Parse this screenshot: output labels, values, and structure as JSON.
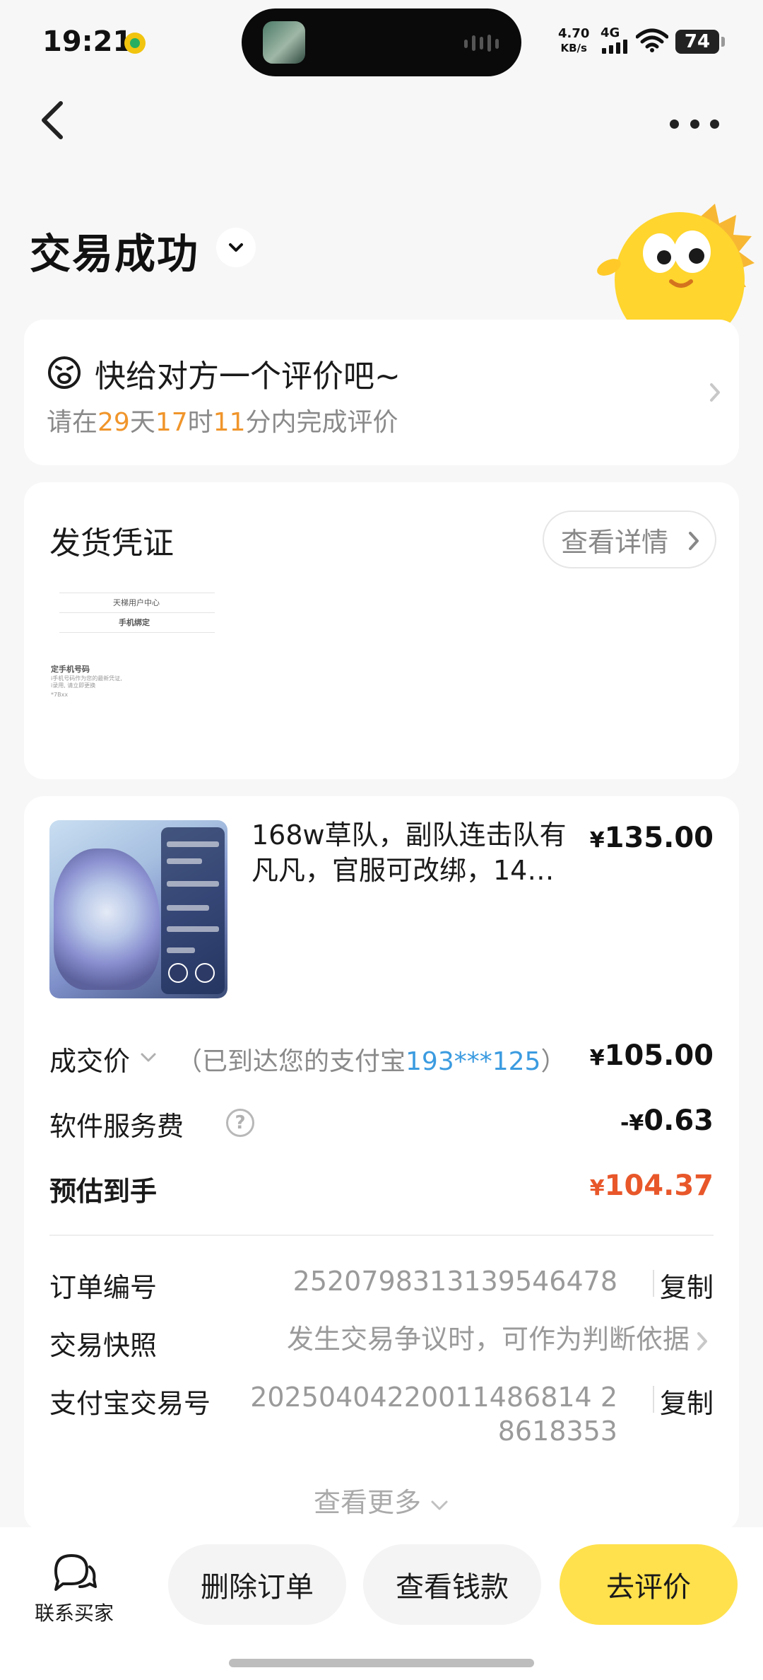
{
  "status_bar": {
    "time": "19:21",
    "net_speed_value": "4.70",
    "net_speed_unit": "KB/s",
    "network": "4G",
    "battery": "74"
  },
  "header": {
    "title": "交易成功"
  },
  "review_card": {
    "title": "快给对方一个评价吧~",
    "prefix": "请在",
    "days": "29",
    "days_unit": "天",
    "hours": "17",
    "hours_unit": "时",
    "minutes": "11",
    "suffix": "分内完成评价"
  },
  "voucher": {
    "title": "发货凭证",
    "detail_button": "查看详情",
    "thumbnail": {
      "header": "天梯用户中心",
      "subheader": "手机绑定",
      "label": "定手机号码",
      "line1": "i手机号码作为您的最新凭证,",
      "line2": "i录用, 请立即更换",
      "line3": "*7Bxx"
    }
  },
  "order": {
    "product_title": "168w草队，副队连击队有凡凡，官服可改绑，14…",
    "product_price_symbol": "¥",
    "product_price": "135.00",
    "deal_label": "成交价",
    "deal_note_prefix": "（已到达您的支付宝",
    "deal_note_account": "193***125",
    "deal_note_suffix": "）",
    "deal_price_symbol": "¥",
    "deal_price": "105.00",
    "fee_label": "软件服务费",
    "fee_help": "?",
    "fee_symbol": "-¥",
    "fee_value": "0.63",
    "estimate_label": "预估到手",
    "estimate_symbol": "¥",
    "estimate_value": "104.37",
    "order_no_label": "订单编号",
    "order_no": "2520798313139546478",
    "copy_label": "复制",
    "snapshot_label": "交易快照",
    "snapshot_value": "发生交易争议时，可作为判断依据",
    "alipay_label": "支付宝交易号",
    "alipay_no_line1": "20250404220011486814 2",
    "alipay_no_line2": "8618353",
    "see_more": "查看更多"
  },
  "bottom_bar": {
    "contact_label": "联系买家",
    "delete_button": "删除订单",
    "view_money_button": "查看钱款",
    "review_button": "去评价"
  },
  "colors": {
    "accent_yellow": "#ffe14d",
    "highlight_orange": "#f0952b",
    "link_blue": "#3b9be0",
    "price_red": "#e8572a"
  },
  "icons": {
    "back": "chevron-left-icon",
    "more": "more-dots-icon",
    "review": "smile-face-icon",
    "contact": "chat-bubble-icon"
  }
}
